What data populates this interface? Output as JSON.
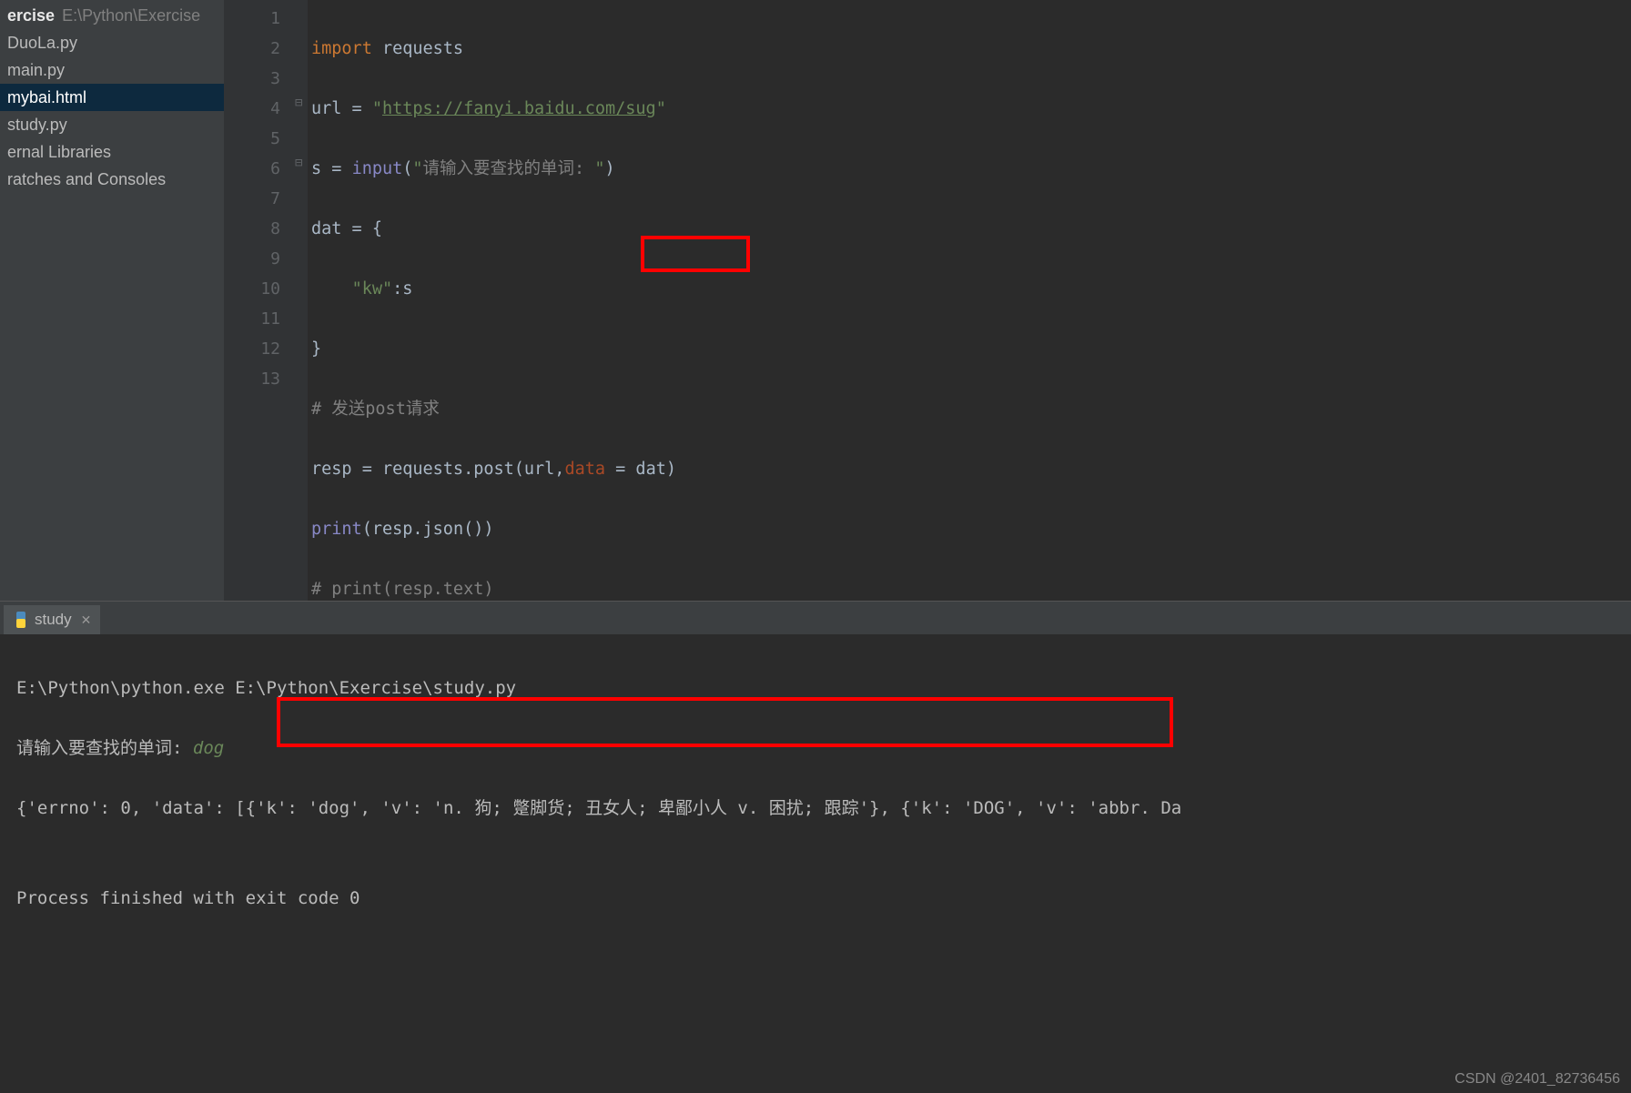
{
  "sidebar": {
    "header_bold": "ercise",
    "header_dim": "E:\\Python\\Exercise",
    "items": [
      {
        "label": "DuoLa.py",
        "selected": false
      },
      {
        "label": "main.py",
        "selected": false
      },
      {
        "label": "mybai.html",
        "selected": true
      },
      {
        "label": "study.py",
        "selected": false
      }
    ],
    "libs": "ernal Libraries",
    "scratches": "ratches and Consoles"
  },
  "editor": {
    "line_numbers": [
      "1",
      "2",
      "3",
      "4",
      "5",
      "6",
      "7",
      "8",
      "9",
      "10",
      "11",
      "12",
      "13"
    ],
    "code": {
      "l1_kw": "import",
      "l1_id": " requests",
      "l2_a": "url = ",
      "l2_q1": "\"",
      "l2_url": "https://fanyi.baidu.com/sug",
      "l2_q2": "\"",
      "l3_a": "s = ",
      "l3_b": "input",
      "l3_c": "(",
      "l3_d": "\"",
      "l3_e": "请输入要查找的单词: ",
      "l3_f": "\"",
      "l3_g": ")",
      "l4": "dat = {",
      "l5_a": "    ",
      "l5_b": "\"kw\"",
      "l5_c": ":s",
      "l6": "}",
      "l7": "# 发送post请求",
      "l8_a": "resp = requests.post(url,",
      "l8_b": "data",
      "l8_c": " = dat)",
      "l9_a": "print",
      "l9_b": "(resp.json())",
      "l10": "# print(resp.text)"
    }
  },
  "console": {
    "tab_label": "study",
    "line1": "E:\\Python\\python.exe E:\\Python\\Exercise\\study.py",
    "line2_prompt": "请输入要查找的单词: ",
    "line2_input": "dog",
    "line3": "{'errno': 0, 'data': [{'k': 'dog', 'v': 'n. 狗; 蹩脚货; 丑女人; 卑鄙小人 v. 困扰; 跟踪'}, {'k': 'DOG', 'v': 'abbr. Da",
    "line4": "",
    "line5": "Process finished with exit code 0"
  },
  "watermark": "CSDN @2401_82736456"
}
